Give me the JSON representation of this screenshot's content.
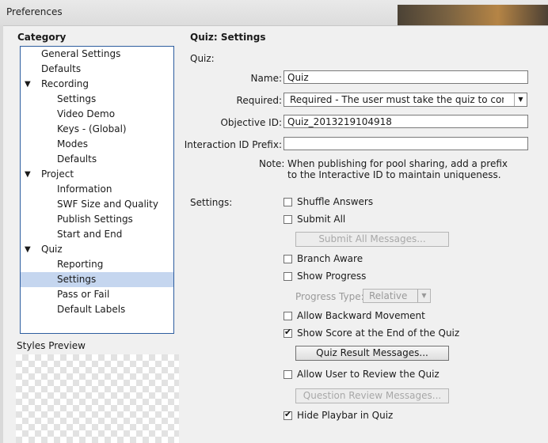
{
  "window": {
    "title": "Preferences"
  },
  "category": {
    "heading": "Category",
    "items": [
      {
        "label": "General Settings",
        "level": 0
      },
      {
        "label": "Defaults",
        "level": 0
      },
      {
        "label": "Recording",
        "level": 0,
        "expanded": true
      },
      {
        "label": "Settings",
        "level": 1
      },
      {
        "label": "Video Demo",
        "level": 1
      },
      {
        "label": "Keys - (Global)",
        "level": 1
      },
      {
        "label": "Modes",
        "level": 1
      },
      {
        "label": "Defaults",
        "level": 1
      },
      {
        "label": "Project",
        "level": 0,
        "expanded": true
      },
      {
        "label": "Information",
        "level": 1
      },
      {
        "label": "SWF Size and Quality",
        "level": 1
      },
      {
        "label": "Publish Settings",
        "level": 1
      },
      {
        "label": "Start and End",
        "level": 1
      },
      {
        "label": "Quiz",
        "level": 0,
        "expanded": true
      },
      {
        "label": "Reporting",
        "level": 1
      },
      {
        "label": "Settings",
        "level": 1,
        "selected": true
      },
      {
        "label": "Pass or Fail",
        "level": 1
      },
      {
        "label": "Default Labels",
        "level": 1
      }
    ],
    "expand_glyph": "▼"
  },
  "styles_preview": {
    "label": "Styles Preview"
  },
  "panel": {
    "title": "Quiz: Settings",
    "quiz_section": "Quiz:",
    "name_label": "Name:",
    "name_value": "Quiz",
    "required_label": "Required:",
    "required_value": "Required - The user must take the quiz to contin...",
    "objective_label": "Objective ID:",
    "objective_value": "Quiz_2013219104918",
    "interaction_label": "Interaction ID Prefix:",
    "interaction_value": "",
    "note_label": "Note:",
    "note_text": "When publishing for pool sharing, add a prefix to the Interactive ID to maintain uniqueness.",
    "settings_label": "Settings:",
    "shuffle_answers": {
      "label": "Shuffle Answers",
      "checked": false
    },
    "submit_all": {
      "label": "Submit All",
      "checked": false
    },
    "submit_all_messages_button": "Submit All Messages...",
    "branch_aware": {
      "label": "Branch Aware",
      "checked": false
    },
    "show_progress": {
      "label": "Show Progress",
      "checked": false
    },
    "progress_type_label": "Progress Type:",
    "progress_type_value": "Relative",
    "allow_backward": {
      "label": "Allow Backward Movement",
      "checked": false
    },
    "show_score": {
      "label": "Show Score at the End of the Quiz",
      "checked": true
    },
    "quiz_result_messages_button": "Quiz Result Messages...",
    "allow_review": {
      "label": "Allow User to Review the Quiz",
      "checked": false
    },
    "question_review_messages_button": "Question Review Messages...",
    "hide_playbar": {
      "label": "Hide Playbar in Quiz",
      "checked": true
    }
  }
}
